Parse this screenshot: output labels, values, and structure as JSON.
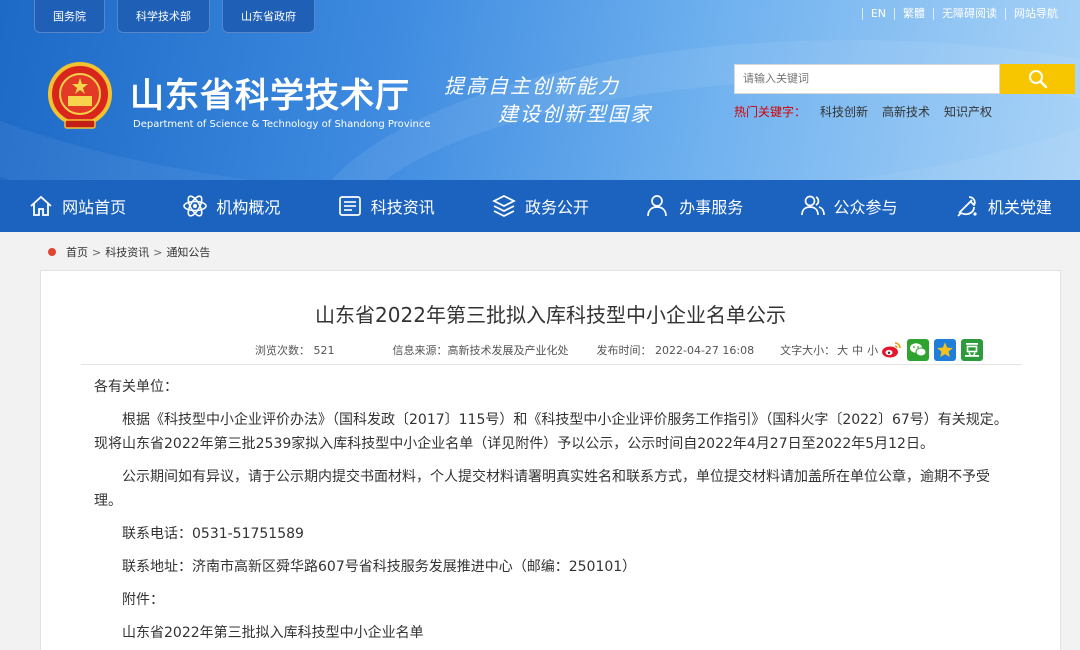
{
  "top_tabs": [
    "国务院",
    "科学技术部",
    "山东省政府"
  ],
  "top_links": [
    "EN",
    "繁體",
    "无障碍阅读",
    "网站导航"
  ],
  "site": {
    "title": "山东省科学技术厅",
    "subtitle": "Department of Science & Technology of Shandong Province",
    "slogan_line1": "提高自主创新能力",
    "slogan_line2": "建设创新型国家"
  },
  "search": {
    "placeholder": "请输入关键词",
    "hot_label": "热门关键字：",
    "hot_words": [
      "科技创新",
      "高新技术",
      "知识产权"
    ]
  },
  "colors": {
    "accent": "#1c63c0",
    "search_button": "#f7c600",
    "hot_label": "#d40000"
  },
  "nav": [
    {
      "label": "网站首页",
      "icon": "home-icon"
    },
    {
      "label": "机构概况",
      "icon": "atom-icon"
    },
    {
      "label": "科技资讯",
      "icon": "news-icon"
    },
    {
      "label": "政务公开",
      "icon": "layers-icon"
    },
    {
      "label": "办事服务",
      "icon": "user-service-icon"
    },
    {
      "label": "公众参与",
      "icon": "people-icon"
    },
    {
      "label": "机关党建",
      "icon": "party-emblem-icon"
    }
  ],
  "breadcrumb": [
    "首页",
    "科技资讯",
    "通知公告"
  ],
  "article": {
    "title": "山东省2022年第三批拟入库科技型中小企业名单公示",
    "views": "浏览次数： 521",
    "source": "信息来源：高新技术发展及产业化处",
    "published": "发布时间： 2022-04-27 16:08",
    "font_size_label": "文字大小：",
    "font_sizes": [
      "大",
      "中",
      "小"
    ],
    "share_icons": [
      "weibo-icon",
      "wechat-icon",
      "qzone-icon",
      "douban-icon"
    ],
    "paragraphs": {
      "greeting": "各有关单位：",
      "p1": "根据《科技型中小企业评价办法》（国科发政〔2017〕115号）和《科技型中小企业评价服务工作指引》（国科火字〔2022〕67号）有关规定。现将山东省2022年第三批2539家拟入库科技型中小企业名单（详见附件）予以公示，公示时间自2022年4月27日至2022年5月12日。",
      "p2": "公示期间如有异议，请于公示期内提交书面材料，个人提交材料请署明真实姓名和联系方式，单位提交材料请加盖所在单位公章，逾期不予受理。",
      "phone": "联系电话：0531-51751589",
      "address": "联系地址：济南市高新区舜华路607号省科技服务发展推进中心（邮编：250101）",
      "attachment_label": "附件：",
      "attachment": "山东省2022年第三批拟入库科技型中小企业名单"
    }
  }
}
